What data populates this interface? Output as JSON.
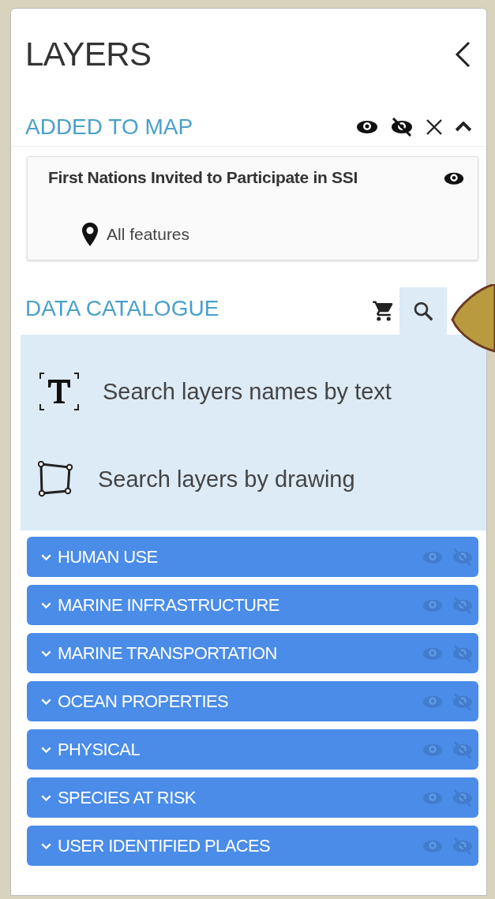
{
  "panel": {
    "title": "LAYERS"
  },
  "added_to_map": {
    "heading": "ADDED TO MAP",
    "expanded": true,
    "layers": [
      {
        "name": "First Nations Invited to Participate in SSI",
        "visible": true,
        "filter": "All features"
      }
    ]
  },
  "data_catalogue": {
    "heading": "DATA CATALOGUE",
    "tools": [
      {
        "kind": "cart",
        "selected": false
      },
      {
        "kind": "search",
        "selected": true
      }
    ],
    "search_options": [
      {
        "kind": "text",
        "label": "Search layers names by text"
      },
      {
        "kind": "drawing",
        "label": "Search layers by drawing"
      }
    ],
    "categories": [
      {
        "label": "HUMAN USE",
        "expanded": false
      },
      {
        "label": "MARINE INFRASTRUCTURE",
        "expanded": false
      },
      {
        "label": "MARINE TRANSPORTATION",
        "expanded": false
      },
      {
        "label": "OCEAN PROPERTIES",
        "expanded": false
      },
      {
        "label": "PHYSICAL",
        "expanded": false
      },
      {
        "label": "SPECIES AT RISK",
        "expanded": false
      },
      {
        "label": "USER IDENTIFIED PLACES",
        "expanded": false
      }
    ]
  }
}
